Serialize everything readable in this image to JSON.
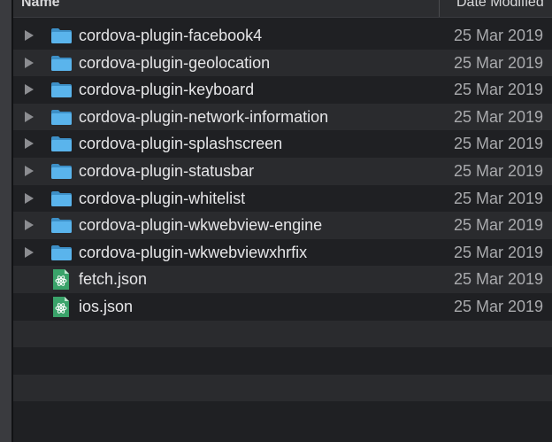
{
  "header": {
    "name_label": "Name",
    "sort_glyph": "⌃",
    "date_label": "Date Modified"
  },
  "files": [
    {
      "name": "cordova-plugin-facebook4",
      "date": "25 Mar 2019",
      "kind": "folder"
    },
    {
      "name": "cordova-plugin-geolocation",
      "date": "25 Mar 2019",
      "kind": "folder"
    },
    {
      "name": "cordova-plugin-keyboard",
      "date": "25 Mar 2019",
      "kind": "folder"
    },
    {
      "name": "cordova-plugin-network-information",
      "date": "25 Mar 2019",
      "kind": "folder"
    },
    {
      "name": "cordova-plugin-splashscreen",
      "date": "25 Mar 2019",
      "kind": "folder"
    },
    {
      "name": "cordova-plugin-statusbar",
      "date": "25 Mar 2019",
      "kind": "folder"
    },
    {
      "name": "cordova-plugin-whitelist",
      "date": "25 Mar 2019",
      "kind": "folder"
    },
    {
      "name": "cordova-plugin-wkwebview-engine",
      "date": "25 Mar 2019",
      "kind": "folder"
    },
    {
      "name": "cordova-plugin-wkwebviewxhrfix",
      "date": "25 Mar 2019",
      "kind": "folder"
    },
    {
      "name": "fetch.json",
      "date": "25 Mar 2019",
      "kind": "json"
    },
    {
      "name": "ios.json",
      "date": "25 Mar 2019",
      "kind": "json"
    }
  ],
  "colors": {
    "folder": "#5ab4ec",
    "json": "#3aa36a"
  }
}
